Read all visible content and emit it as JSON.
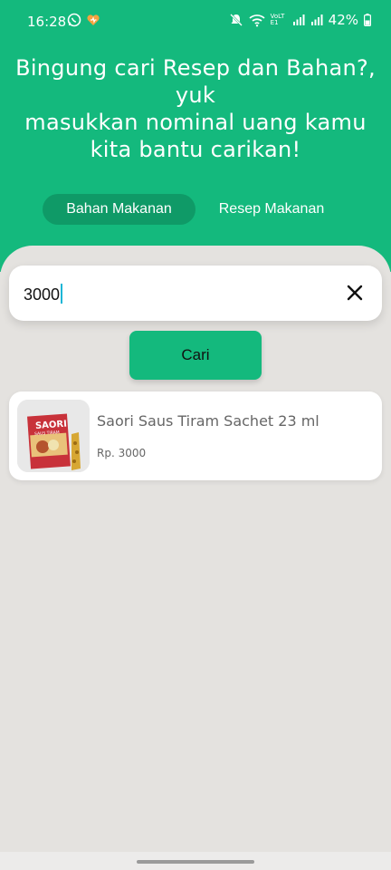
{
  "status_bar": {
    "time": "16:28",
    "battery": "42%",
    "network_label": "VoLTE1"
  },
  "header": {
    "headline_lines": [
      "Bingung cari Resep dan Bahan?,",
      "yuk",
      "masukkan nominal uang kamu",
      "kita bantu carikan!"
    ],
    "accent_color": "#14b97d"
  },
  "tabs": [
    {
      "label": "Bahan Makanan",
      "active": true
    },
    {
      "label": "Resep Makanan",
      "active": false
    }
  ],
  "search": {
    "value": "3000",
    "clear_icon": "close-icon",
    "button_label": "Cari"
  },
  "results": [
    {
      "title": "Saori Saus Tiram Sachet 23 ml",
      "price": "Rp. 3000",
      "image_brand_text": "SAORI",
      "image_sub_text": "SAUS TIRAM"
    }
  ]
}
